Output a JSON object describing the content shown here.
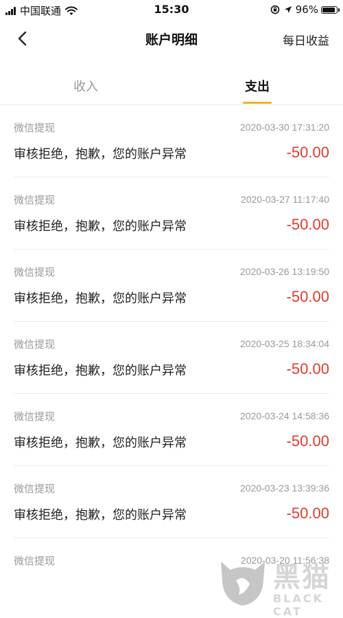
{
  "status_bar": {
    "carrier": "中国联通",
    "time": "15:30",
    "battery": "96%",
    "battery_level": 0.96
  },
  "nav": {
    "title": "账户明细",
    "right_action": "每日收益"
  },
  "tabs": [
    {
      "label": "收入",
      "active": false
    },
    {
      "label": "支出",
      "active": true
    }
  ],
  "accent_color": "#f4b21e",
  "amount_color": "#e63a2c",
  "transactions": [
    {
      "type": "微信提现",
      "time": "2020-03-30 17:31:20",
      "desc": "审核拒绝，抱歉，您的账户异常",
      "amount": "-50.00"
    },
    {
      "type": "微信提现",
      "time": "2020-03-27 11:17:40",
      "desc": "审核拒绝，抱歉，您的账户异常",
      "amount": "-50.00"
    },
    {
      "type": "微信提现",
      "time": "2020-03-26 13:19:50",
      "desc": "审核拒绝，抱歉，您的账户异常",
      "amount": "-50.00"
    },
    {
      "type": "微信提现",
      "time": "2020-03-25 18:34:04",
      "desc": "审核拒绝，抱歉，您的账户异常",
      "amount": "-50.00"
    },
    {
      "type": "微信提现",
      "time": "2020-03-24 14:58:36",
      "desc": "审核拒绝，抱歉，您的账户异常",
      "amount": "-50.00"
    },
    {
      "type": "微信提现",
      "time": "2020-03-23 13:39:36",
      "desc": "审核拒绝，抱歉，您的账户异常",
      "amount": "-50.00"
    },
    {
      "type": "微信提现",
      "time": "2020-03-20 11:56:38",
      "desc": "",
      "amount": ""
    }
  ],
  "watermark": {
    "text": "黑猫",
    "subtext": "BLACK CAT"
  }
}
